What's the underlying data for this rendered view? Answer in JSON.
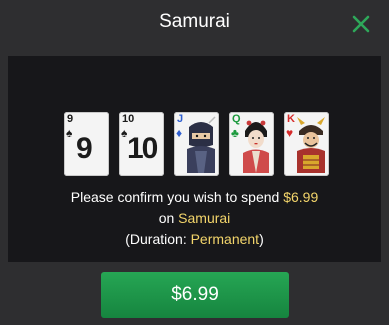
{
  "dialog": {
    "title": "Samurai",
    "close_icon": "close-x-icon",
    "accent_color": "#2ea85a"
  },
  "cards": [
    {
      "rank": "9",
      "suit": "spades",
      "suit_glyph": "♠",
      "color": "#1b1b1b",
      "kind": "number"
    },
    {
      "rank": "10",
      "suit": "spades",
      "suit_glyph": "♠",
      "color": "#1b1b1b",
      "kind": "number"
    },
    {
      "rank": "J",
      "suit": "diamonds",
      "suit_glyph": "♦",
      "color": "#2f5fd0",
      "kind": "face"
    },
    {
      "rank": "Q",
      "suit": "clubs",
      "suit_glyph": "♣",
      "color": "#1c9a3e",
      "kind": "face"
    },
    {
      "rank": "K",
      "suit": "hearts",
      "suit_glyph": "♥",
      "color": "#d62b2b",
      "kind": "face"
    }
  ],
  "message": {
    "line1_prefix": "Please confirm you wish to spend ",
    "price": "$6.99",
    "line2_prefix": "on ",
    "item_name": "Samurai",
    "line3_prefix": "(Duration: ",
    "duration": "Permanent",
    "line3_suffix": ")"
  },
  "buy_button": {
    "label": "$6.99"
  }
}
